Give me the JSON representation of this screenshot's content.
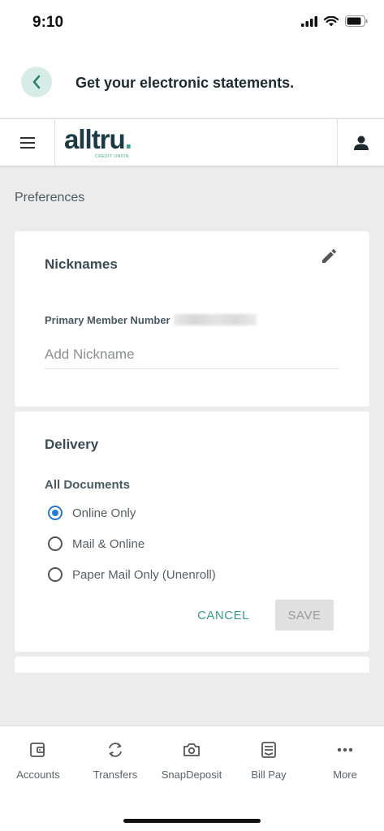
{
  "status_bar": {
    "time": "9:10"
  },
  "header": {
    "title": "Get your electronic statements."
  },
  "app_bar": {
    "logo_text": "alltru",
    "logo_dot": ".",
    "logo_subtext": "CREDIT UNION"
  },
  "section": {
    "title": "Preferences"
  },
  "nicknames": {
    "title": "Nicknames",
    "member_label": "Primary Member Number",
    "input_placeholder": "Add Nickname"
  },
  "delivery": {
    "title": "Delivery",
    "group_label": "All Documents",
    "options": [
      {
        "label": "Online Only",
        "selected": true
      },
      {
        "label": "Mail & Online",
        "selected": false
      },
      {
        "label": "Paper Mail Only (Unenroll)",
        "selected": false
      }
    ],
    "cancel_label": "CANCEL",
    "save_label": "SAVE"
  },
  "bottom_nav": {
    "items": [
      {
        "label": "Accounts",
        "icon": "wallet-icon"
      },
      {
        "label": "Transfers",
        "icon": "transfer-arrows-icon"
      },
      {
        "label": "SnapDeposit",
        "icon": "camera-icon"
      },
      {
        "label": "Bill Pay",
        "icon": "bill-icon"
      },
      {
        "label": "More",
        "icon": "more-dots-icon"
      }
    ]
  },
  "colors": {
    "accent": "#3a9c8a",
    "radio_selected": "#2a78d6",
    "logo_dark": "#1c3a45"
  }
}
